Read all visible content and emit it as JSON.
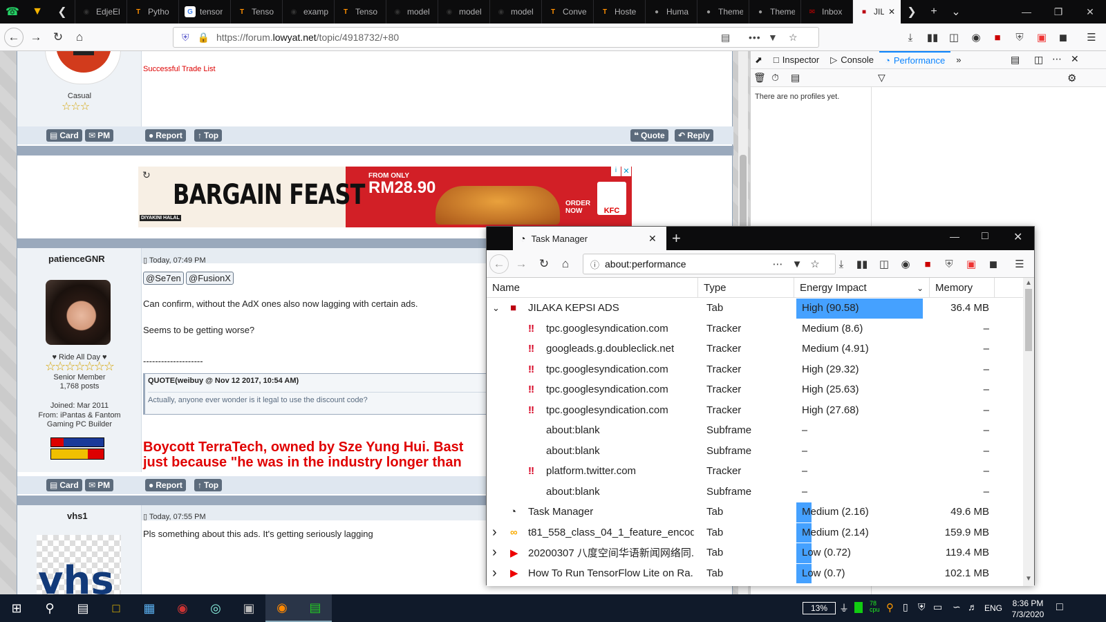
{
  "browser": {
    "tabs": [
      {
        "label": "",
        "icon": "whatsapp-icon",
        "color": "#25d366"
      },
      {
        "label": "",
        "icon": "pocket-icon",
        "color": "#f5b400"
      },
      {
        "label": "EdjeEl",
        "icon": "github-icon",
        "color": "#333"
      },
      {
        "label": "Pytho",
        "icon": "tensorflow-icon",
        "color": "#ff8f00"
      },
      {
        "label": "tensor",
        "icon": "google-icon",
        "color": "#fff"
      },
      {
        "label": "Tenso",
        "icon": "tensorflow-icon",
        "color": "#ff8f00"
      },
      {
        "label": "examp",
        "icon": "github-icon",
        "color": "#333"
      },
      {
        "label": "Tenso",
        "icon": "tensorflow-icon",
        "color": "#ff8f00"
      },
      {
        "label": "model",
        "icon": "github-icon",
        "color": "#333"
      },
      {
        "label": "model",
        "icon": "github-icon",
        "color": "#333"
      },
      {
        "label": "model",
        "icon": "github-icon",
        "color": "#333"
      },
      {
        "label": "Conve",
        "icon": "tensorflow-icon",
        "color": "#ff8f00"
      },
      {
        "label": "Hoste",
        "icon": "tensorflow-icon",
        "color": "#ff8f00"
      },
      {
        "label": "Huma",
        "icon": "apple-icon",
        "color": "#999"
      },
      {
        "label": "Theme",
        "icon": "apple-icon",
        "color": "#999"
      },
      {
        "label": "Theme",
        "icon": "apple-icon",
        "color": "#999"
      },
      {
        "label": "Inbox",
        "icon": "mail-icon",
        "color": "#c00"
      },
      {
        "label": "JIL",
        "icon": "ad-icon",
        "color": "#b01"
      }
    ],
    "url_prefix": "https://forum.",
    "url_domain": "lowyat.net",
    "url_path": "/topic/4918732/+80"
  },
  "forum": {
    "trade_list": "Successful Trade List",
    "user1_rank": "Casual",
    "card": "Card",
    "pm": "PM",
    "report": "Report",
    "top": "Top",
    "quote": "Quote",
    "reply": "Reply",
    "ad_headline": "BARGAIN FEAST",
    "ad_from": "FROM ONLY",
    "ad_price": "RM28.90",
    "ad_order": "ORDER NOW",
    "ad_brand": "KFC",
    "ad_halal": "DIYAKINI HALAL",
    "post2": {
      "user": "patienceGNR",
      "time": "Today, 07:49 PM",
      "mention1": "@Se7en",
      "mention2": "@FusionX",
      "line1": "Can confirm, without the AdX ones also now lagging with certain ads.",
      "line2": "Seems to be getting worse?",
      "sep": "--------------------",
      "quote_head": "QUOTE(weibuy @ Nov 12 2017, 10:54 AM)",
      "quote_body": "Actually, anyone ever wonder is it legal to use the discount code?",
      "tagline": "♥ Ride All Day ♥",
      "rank": "Senior Member",
      "posts": "1,768 posts",
      "joined": "Joined: Mar 2011",
      "from": "From: iPantas & Fantom",
      "from2": "Gaming PC Builder",
      "sig1": "Boycott TerraTech, owned by Sze Yung Hui. Bast",
      "sig2": "just because \"he was in the industry longer than"
    },
    "post3": {
      "user": "vhs1",
      "time": "Today, 07:55 PM",
      "text": "Pls something about this ads. It's getting seriously lagging"
    }
  },
  "devtools": {
    "tabs": [
      "Inspector",
      "Console",
      "Performance"
    ],
    "empty": "There are no profiles yet."
  },
  "taskmanager": {
    "tab_title": "Task Manager",
    "url": "about:performance",
    "columns": [
      "Name",
      "Type",
      "Energy Impact",
      "Memory"
    ],
    "rows": [
      {
        "expand": "v",
        "icon": "ad-icon",
        "name": "JILAKA KEPSI ADS",
        "type": "Tab",
        "energy": "High (90.58)",
        "memory": "36.4 MB",
        "indent": 0,
        "bar": 1.0
      },
      {
        "expand": "",
        "icon": "tracker-icon",
        "name": "tpc.googlesyndication.com",
        "type": "Tracker",
        "energy": "Medium (8.6)",
        "memory": "–",
        "indent": 1,
        "bar": 0
      },
      {
        "expand": "",
        "icon": "tracker-icon",
        "name": "googleads.g.doubleclick.net",
        "type": "Tracker",
        "energy": "Medium (4.91)",
        "memory": "–",
        "indent": 1,
        "bar": 0
      },
      {
        "expand": "",
        "icon": "tracker-icon",
        "name": "tpc.googlesyndication.com",
        "type": "Tracker",
        "energy": "High (29.32)",
        "memory": "–",
        "indent": 1,
        "bar": 0
      },
      {
        "expand": "",
        "icon": "tracker-icon",
        "name": "tpc.googlesyndication.com",
        "type": "Tracker",
        "energy": "High (25.63)",
        "memory": "–",
        "indent": 1,
        "bar": 0
      },
      {
        "expand": "",
        "icon": "tracker-icon",
        "name": "tpc.googlesyndication.com",
        "type": "Tracker",
        "energy": "High (27.68)",
        "memory": "–",
        "indent": 1,
        "bar": 0
      },
      {
        "expand": "",
        "icon": "",
        "name": "about:blank",
        "type": "Subframe",
        "energy": "–",
        "memory": "–",
        "indent": 1,
        "bar": 0
      },
      {
        "expand": "",
        "icon": "",
        "name": "about:blank",
        "type": "Subframe",
        "energy": "–",
        "memory": "–",
        "indent": 1,
        "bar": 0
      },
      {
        "expand": "",
        "icon": "tracker-icon",
        "name": "platform.twitter.com",
        "type": "Tracker",
        "energy": "–",
        "memory": "–",
        "indent": 1,
        "bar": 0
      },
      {
        "expand": "",
        "icon": "",
        "name": "about:blank",
        "type": "Subframe",
        "energy": "–",
        "memory": "–",
        "indent": 1,
        "bar": 0
      },
      {
        "expand": "",
        "icon": "gauge-icon",
        "name": "Task Manager",
        "type": "Tab",
        "energy": "Medium (2.16)",
        "memory": "49.6 MB",
        "indent": 0,
        "bar": 0.12
      },
      {
        "expand": ">",
        "icon": "colab-icon",
        "name": "t81_558_class_04_1_feature_encode...",
        "type": "Tab",
        "energy": "Medium (2.14)",
        "memory": "159.9 MB",
        "indent": 0,
        "bar": 0.12
      },
      {
        "expand": ">",
        "icon": "youtube-icon",
        "name": "20200307 八度空间华语新闻网络同...",
        "type": "Tab",
        "energy": "Low (0.72)",
        "memory": "119.4 MB",
        "indent": 0,
        "bar": 0.12
      },
      {
        "expand": ">",
        "icon": "youtube-icon",
        "name": "How To Run TensorFlow Lite on Ra...",
        "type": "Tab",
        "energy": "Low (0.7)",
        "memory": "102.1 MB",
        "indent": 0,
        "bar": 0.12
      }
    ]
  },
  "taskbar": {
    "battery": "13%",
    "lang": "ENG",
    "time": "8:36 PM",
    "date": "7/3/2020"
  },
  "colors": {
    "accent": "#0a84ff",
    "energy_bar": "#45a1ff",
    "alert_red": "#e00000"
  }
}
